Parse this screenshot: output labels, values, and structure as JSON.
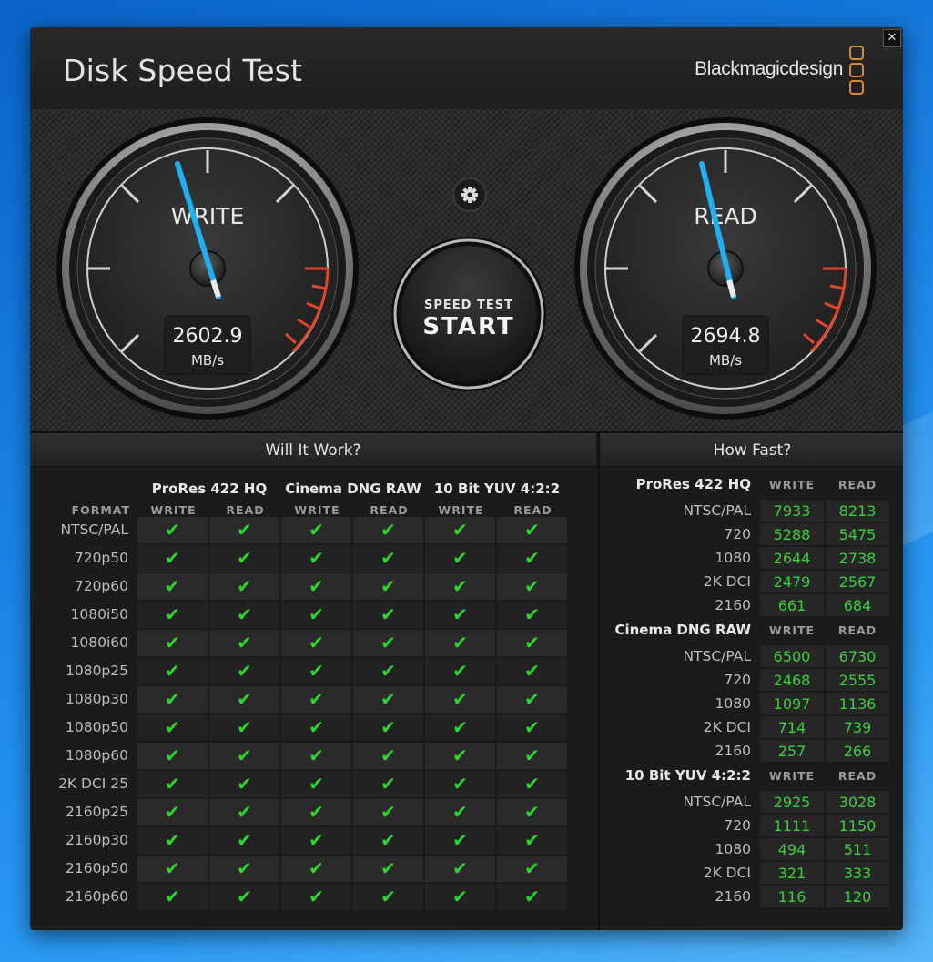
{
  "app": {
    "title": "Disk Speed Test",
    "brand": "Blackmagicdesign",
    "close_label": "✕"
  },
  "colors": {
    "accent_needle": "#1fb0f0",
    "check": "#2fd52f",
    "value": "#38d038",
    "redline": "#e0452d",
    "logo": "#d98a2b"
  },
  "gauges": {
    "write": {
      "label": "WRITE",
      "value": "2602.9",
      "unit": "MB/s"
    },
    "read": {
      "label": "READ",
      "value": "2694.8",
      "unit": "MB/s"
    }
  },
  "start_button": {
    "line1": "SPEED TEST",
    "line2": "START"
  },
  "settings_icon": "gear-icon",
  "will_it_work": {
    "title": "Will It Work?",
    "format_header": "FORMAT",
    "groups": [
      {
        "name": "ProRes 422 HQ",
        "cols": [
          "WRITE",
          "READ"
        ]
      },
      {
        "name": "Cinema DNG RAW",
        "cols": [
          "WRITE",
          "READ"
        ]
      },
      {
        "name": "10 Bit YUV 4:2:2",
        "cols": [
          "WRITE",
          "READ"
        ]
      }
    ],
    "check_glyph": "✔",
    "rows": [
      "NTSC/PAL",
      "720p50",
      "720p60",
      "1080i50",
      "1080i60",
      "1080p25",
      "1080p30",
      "1080p50",
      "1080p60",
      "2K DCI 25",
      "2160p25",
      "2160p30",
      "2160p50",
      "2160p60"
    ]
  },
  "how_fast": {
    "title": "How Fast?",
    "col_write": "WRITE",
    "col_read": "READ",
    "groups": [
      {
        "name": "ProRes 422 HQ",
        "rows": [
          {
            "label": "NTSC/PAL",
            "write": "7933",
            "read": "8213"
          },
          {
            "label": "720",
            "write": "5288",
            "read": "5475"
          },
          {
            "label": "1080",
            "write": "2644",
            "read": "2738"
          },
          {
            "label": "2K DCI",
            "write": "2479",
            "read": "2567"
          },
          {
            "label": "2160",
            "write": "661",
            "read": "684"
          }
        ]
      },
      {
        "name": "Cinema DNG RAW",
        "rows": [
          {
            "label": "NTSC/PAL",
            "write": "6500",
            "read": "6730"
          },
          {
            "label": "720",
            "write": "2468",
            "read": "2555"
          },
          {
            "label": "1080",
            "write": "1097",
            "read": "1136"
          },
          {
            "label": "2K DCI",
            "write": "714",
            "read": "739"
          },
          {
            "label": "2160",
            "write": "257",
            "read": "266"
          }
        ]
      },
      {
        "name": "10 Bit YUV 4:2:2",
        "rows": [
          {
            "label": "NTSC/PAL",
            "write": "2925",
            "read": "3028"
          },
          {
            "label": "720",
            "write": "1111",
            "read": "1150"
          },
          {
            "label": "1080",
            "write": "494",
            "read": "511"
          },
          {
            "label": "2K DCI",
            "write": "321",
            "read": "333"
          },
          {
            "label": "2160",
            "write": "116",
            "read": "120"
          }
        ]
      }
    ]
  }
}
